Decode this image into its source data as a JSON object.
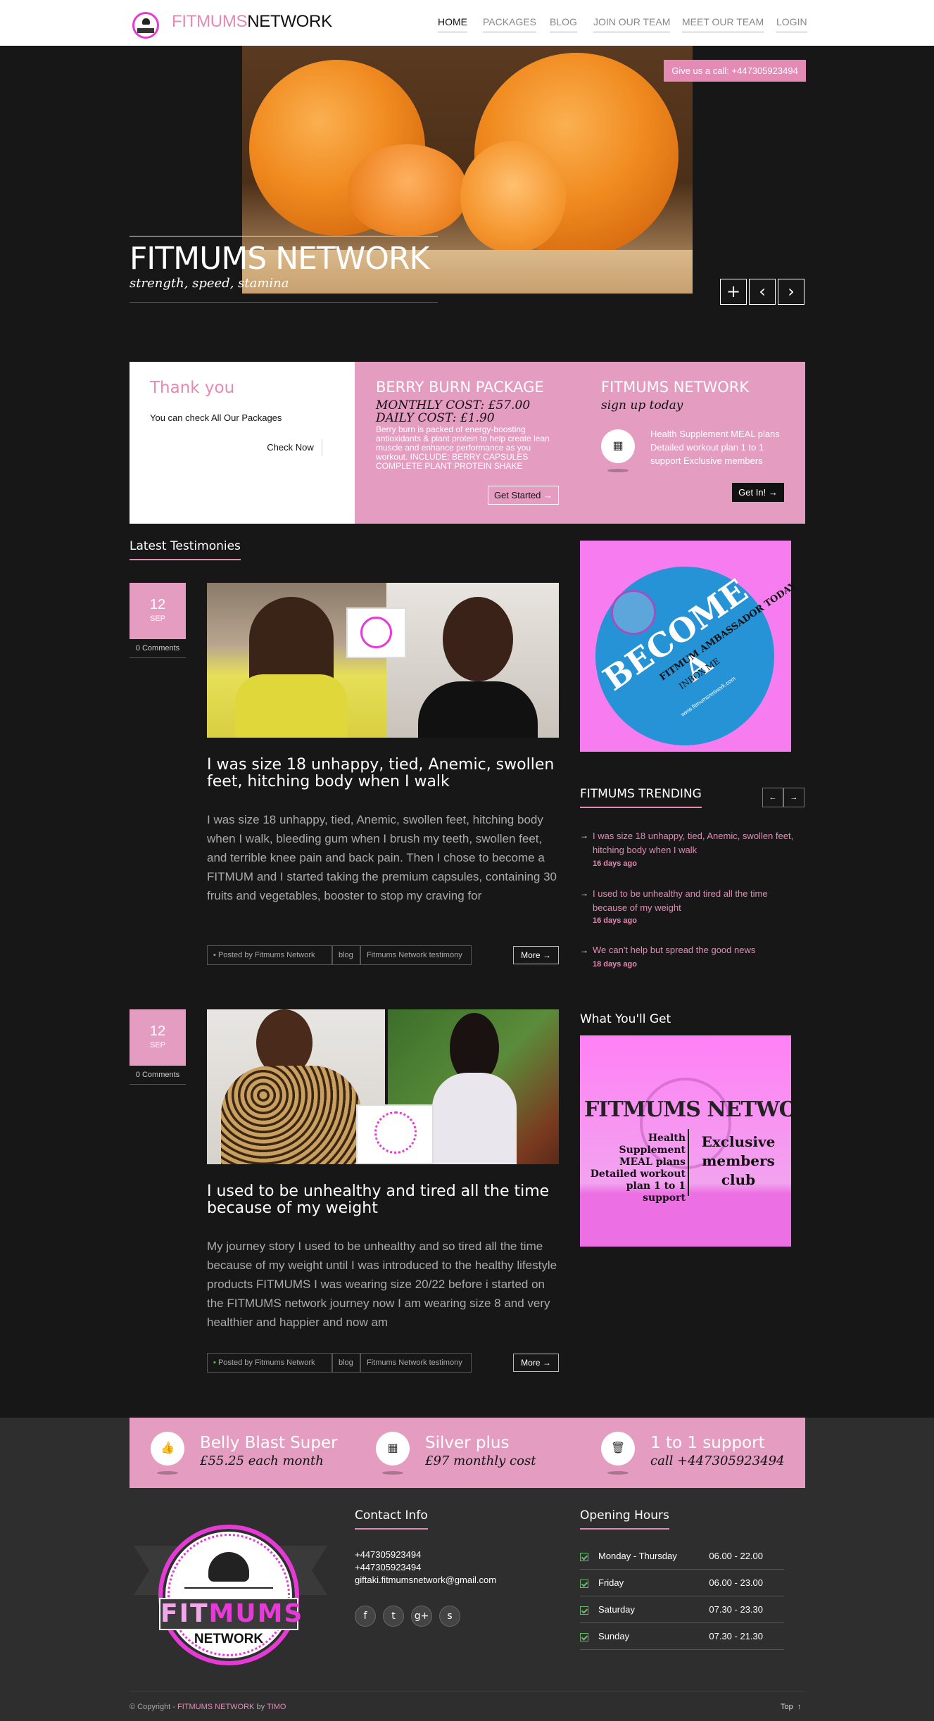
{
  "header": {
    "logo_part1": "FITMUMS",
    "logo_part2": "NETWORK",
    "nav": [
      "HOME",
      "PACKAGES",
      "BLOG",
      "JOIN OUR TEAM",
      "MEET OUR TEAM",
      "LOGIN"
    ]
  },
  "hero": {
    "call_button": "Give us a call: +447305923494",
    "title": "FITMUMS NETWORK",
    "subtitle": "strength, speed, stamina",
    "controls": [
      "+",
      "‹",
      "›"
    ]
  },
  "packages": {
    "thank_title": "Thank you",
    "thank_text": "You can check All Our Packages",
    "check_now": "Check Now",
    "berry_title": "BERRY BURN PACKAGE",
    "berry_monthly": "MONTHLY COST: £57.00",
    "berry_daily": "DAILY COST: £1.90",
    "berry_desc": "Berry burn is packed of energy-boosting antioxidants & plant protein to help create lean muscle and enhance performance as you workout. INCLUDE: BERRY CAPSULES COMPLETE PLANT PROTEIN SHAKE",
    "get_started": "Get Started",
    "signup_title": "FITMUMS NETWORK",
    "signup_sub": "sign up today",
    "signup_desc": "Health Supplement MEAL plans Detailed workout plan 1 to 1 support Exclusive members",
    "get_in": "Get In!"
  },
  "testimonies": {
    "heading": "Latest Testimonies",
    "articles": [
      {
        "day": "12",
        "month": "SEP",
        "comments": "0 Comments",
        "title": "I was size 18 unhappy, tied, Anemic, swollen feet, hitching body when I walk",
        "body": "I was size 18 unhappy, tied, Anemic, swollen feet, hitching body when I walk, bleeding gum when I brush my teeth, swollen feet, and terrible knee pain and back pain. Then I chose to become a FITMUM and I started taking the premium capsules, containing 30 fruits and vegetables, booster to stop my craving for",
        "posted_by": "Posted by Fitmums Network",
        "tag1": "blog",
        "tag2": "Fitmums Network testimony",
        "more": "More"
      },
      {
        "day": "12",
        "month": "SEP",
        "comments": "0 Comments",
        "title": "I used to be unhealthy and  tired all the time because of my weight",
        "body": "My journey story I used to be unhealthy and so tired all the time because of my weight until I was introduced to the healthy lifestyle products FITMUMS I was wearing size 20/22 before i started on the FITMUMS network journey now I am wearing size 8 and very healthier and happier and now am",
        "posted_by": "Posted by Fitmums Network",
        "tag1": "blog",
        "tag2": "Fitmums Network testimony",
        "more": "More"
      }
    ]
  },
  "sidebar": {
    "ambassador": {
      "become": "BECOME A",
      "line": "FITMUM AMBASSADOR TODAY",
      "inbox": "INBOX ME",
      "site": "www.fitmumsnetwork.com"
    },
    "trending_heading": "FITMUMS TRENDING",
    "trending": [
      {
        "title": "I was size 18 unhappy, tied, Anemic, swollen feet, hitching body when I walk",
        "date": "16 days ago"
      },
      {
        "title": "I used to be unhealthy and  tired all the time because of my weight",
        "date": "16 days ago"
      },
      {
        "title": "We can't help but spread the good news",
        "date": "18 days ago"
      }
    ],
    "get_heading": "What You'll Get",
    "get_image": {
      "title": "FITMUMS NETWORK",
      "left": "Health Supplement MEAL plans Detailed workout plan 1 to 1 support",
      "right": "Exclusive members club"
    }
  },
  "features": [
    {
      "title": "Belly Blast Super",
      "sub": "£55.25 each month",
      "icon": "thumbs-up-icon"
    },
    {
      "title": "Silver plus",
      "sub": "£97 monthly cost",
      "icon": "calendar-icon"
    },
    {
      "title": "1 to 1 support",
      "sub": "call +447305923494",
      "icon": "trash-icon"
    }
  ],
  "footer": {
    "badge_fit": "FIT",
    "badge_mums": "MUMS",
    "badge_network": "NETWORK",
    "contact_heading": "Contact Info",
    "phone1": "+447305923494",
    "phone2": "+447305923494",
    "email": "giftaki.fitmumsnetwork@gmail.com",
    "hours_heading": "Opening Hours",
    "hours": [
      {
        "day": "Monday - Thursday",
        "time": "06.00 - 22.00"
      },
      {
        "day": "Friday",
        "time": "06.00 - 23.00"
      },
      {
        "day": "Saturday",
        "time": "07.30 - 23.30"
      },
      {
        "day": "Sunday",
        "time": "07.30 - 21.30"
      }
    ],
    "copyright_prefix": "© Copyright - ",
    "copyright_brand": "FITMUMS NETWORK",
    "copyright_by": " by ",
    "copyright_author": "TIMO",
    "top": "Top"
  },
  "colors": {
    "accent": "#e48ab5",
    "band": "#e59cc1",
    "dark": "#171718"
  }
}
